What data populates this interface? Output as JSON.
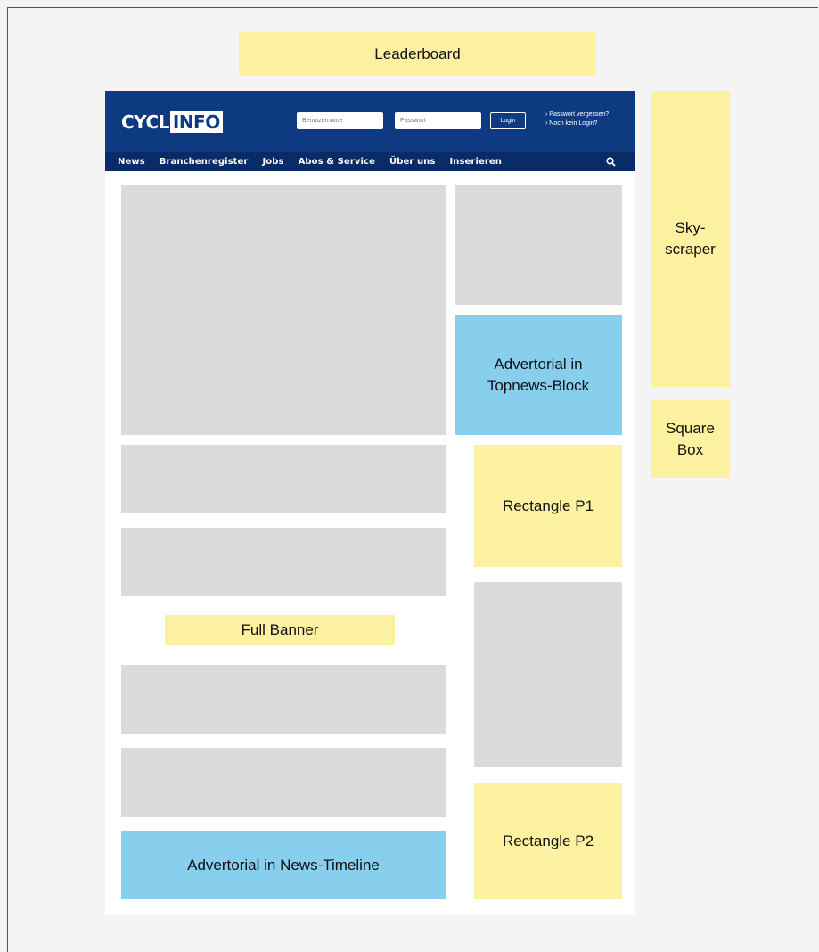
{
  "ads": {
    "leaderboard": "Leaderboard",
    "skyscraper_line1": "Sky-",
    "skyscraper_line2": "scraper",
    "squarebox_line1": "Square",
    "squarebox_line2": "Box",
    "rectangle_p1": "Rectangle P1",
    "rectangle_p2": "Rectangle P2",
    "full_banner": "Full Banner",
    "advertorial_topnews_line1": "Advertorial in",
    "advertorial_topnews_line2": "Topnews-Block",
    "advertorial_timeline": "Advertorial in News-Timeline"
  },
  "site": {
    "logo_part1": "CYCL",
    "logo_part2": "INFO",
    "username_placeholder": "Benutzername",
    "password_placeholder": "Passwort",
    "login_label": "Login",
    "forgot_password": "› Passwort vergessen?",
    "no_login": "› Noch kein Login?"
  },
  "nav": {
    "items": [
      "News",
      "Branchenregister",
      "Jobs",
      "Abos & Service",
      "Über uns",
      "Inserieren"
    ]
  },
  "icons": {
    "search": "search-icon"
  },
  "colors": {
    "ad_yellow": "#fbf1a0",
    "advertorial_blue": "#88cfee",
    "placeholder_gray": "#dadbdd",
    "header_blue": "#0e3a82"
  }
}
